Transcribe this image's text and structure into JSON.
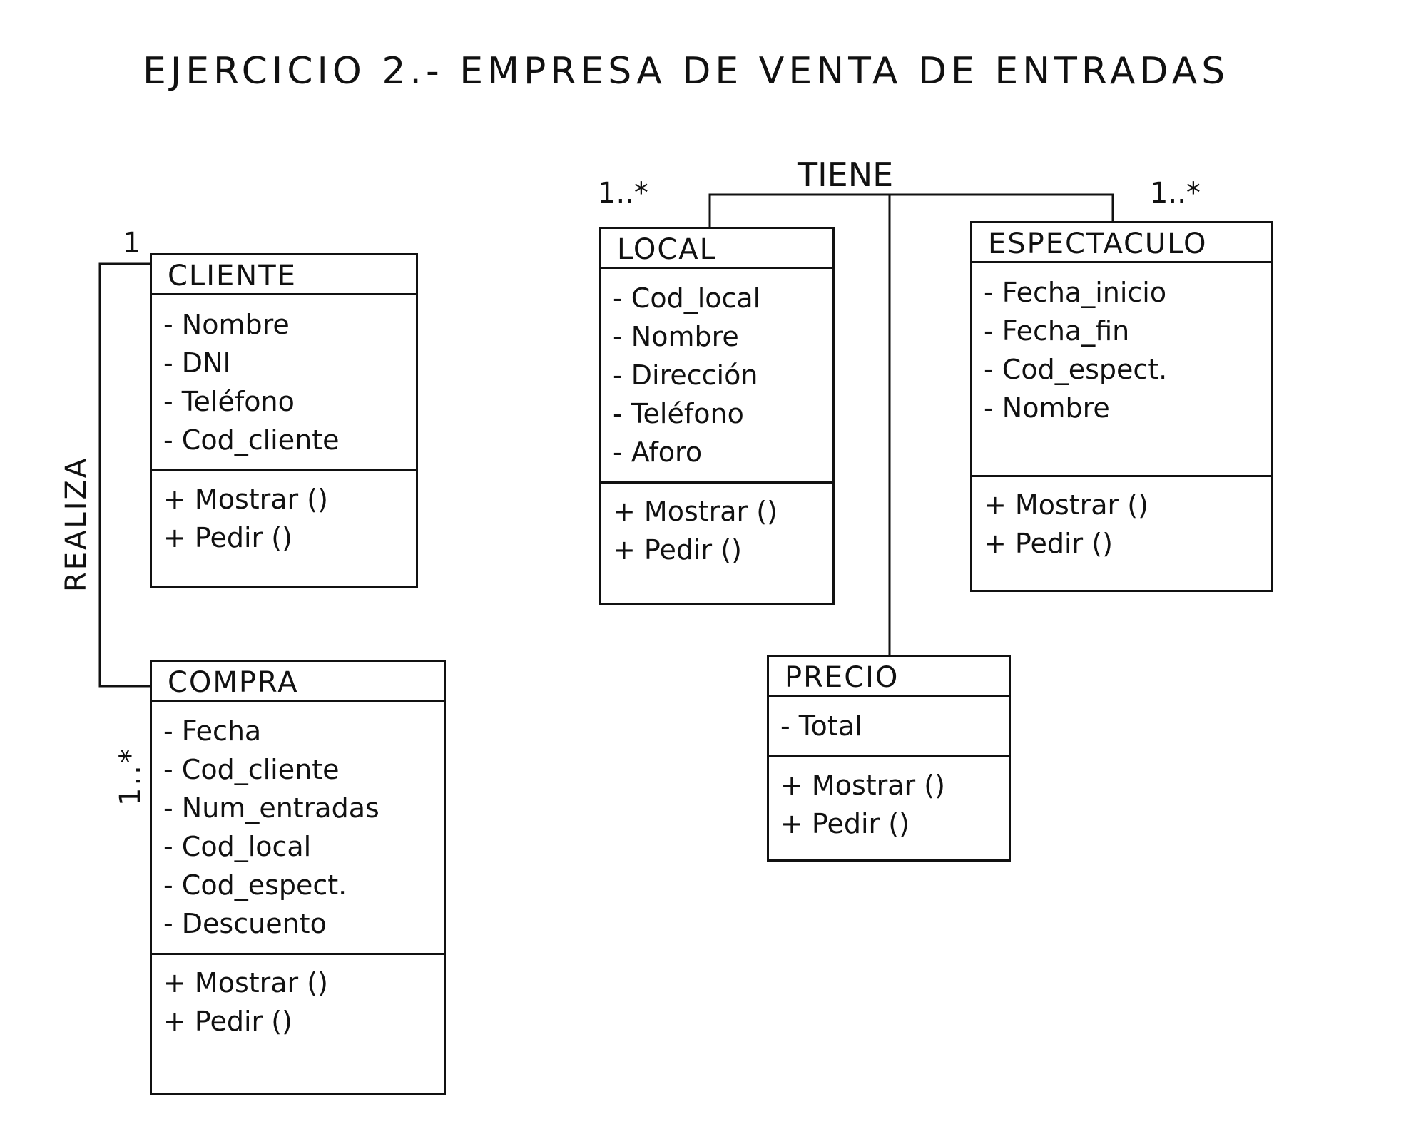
{
  "title": "EJERCICIO 2.- EMPRESA DE VENTA DE ENTRADAS",
  "classes": {
    "cliente": {
      "name": "CLIENTE",
      "attributes": [
        "- Nombre",
        "- DNI",
        "- Teléfono",
        "- Cod_cliente"
      ],
      "operations": [
        "+ Mostrar ()",
        "+ Pedir ()"
      ]
    },
    "compra": {
      "name": "COMPRA",
      "attributes": [
        "- Fecha",
        "- Cod_cliente",
        "- Num_entradas",
        "- Cod_local",
        "- Cod_espect.",
        "- Descuento"
      ],
      "operations": [
        "+ Mostrar ()",
        "+ Pedir ()"
      ]
    },
    "local": {
      "name": "LOCAL",
      "attributes": [
        "- Cod_local",
        "- Nombre",
        "- Dirección",
        "- Teléfono",
        "- Aforo"
      ],
      "operations": [
        "+ Mostrar ()",
        "+ Pedir ()"
      ]
    },
    "espectaculo": {
      "name": "ESPECTACULO",
      "attributes": [
        "- Fecha_inicio",
        "- Fecha_fin",
        "- Cod_espect.",
        "- Nombre"
      ],
      "operations": [
        "+ Mostrar ()",
        "+ Pedir ()"
      ]
    },
    "precio": {
      "name": "PRECIO",
      "attributes": [
        "- Total"
      ],
      "operations": [
        "+ Mostrar ()",
        "+ Pedir ()"
      ]
    }
  },
  "associations": {
    "realiza": {
      "label": "REALIZA",
      "multiplicity_cliente": "1",
      "multiplicity_compra": "1..*"
    },
    "tiene": {
      "label": "TIENE",
      "multiplicity_local": "1..*",
      "multiplicity_espectaculo": "1..*"
    }
  }
}
